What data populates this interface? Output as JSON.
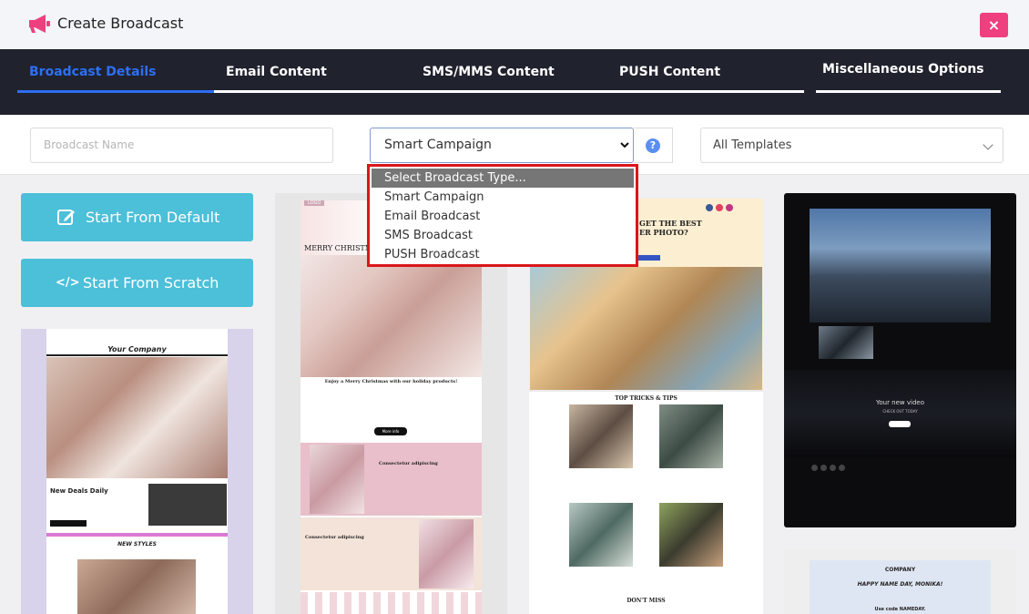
{
  "header": {
    "title": "Create Broadcast",
    "close_label": "×"
  },
  "tabs": [
    {
      "label": "Broadcast Details",
      "active": true
    },
    {
      "label": "Email Content",
      "active": false
    },
    {
      "label": "SMS/MMS Content",
      "active": false
    },
    {
      "label": "PUSH Content",
      "active": false
    },
    {
      "label": "Miscellaneous Options",
      "active": false
    }
  ],
  "form": {
    "name_placeholder": "Broadcast Name",
    "type_value": "Smart Campaign",
    "help_label": "?",
    "templates_value": "All Templates"
  },
  "dropdown": {
    "options": [
      "Select Broadcast Type...",
      "Smart Campaign",
      "Email Broadcast",
      "SMS Broadcast",
      "PUSH Broadcast"
    ],
    "highlighted": "Select Broadcast Type..."
  },
  "actions": {
    "start_default": "Start From Default",
    "start_scratch": "Start From Scratch"
  },
  "templates": {
    "t1": {
      "company": "Your Company",
      "deals": "New Deals Daily",
      "styles": "NEW STYLES"
    },
    "t2": {
      "logo": "LOGO",
      "headline": "MERRY CHRISTM",
      "subhead": "Enjoy a Merry Christmas with our holiday products!",
      "more": "More info",
      "section1": "Consectetur adipiscing",
      "section2": "Consectetur adipiscing"
    },
    "t3": {
      "headline1": "GET THE BEST",
      "headline2": "ER PHOTO?",
      "tips": "TOP TRICKS & TIPS",
      "miss": "DON'T MISS"
    },
    "t4": {
      "video": "Your new video",
      "checkout": "CHECK OUT TODAY"
    },
    "t5": {
      "company": "COMPANY",
      "greeting": "HAPPY NAME DAY, MONIKA!",
      "code": "Use code NAMEDAY."
    }
  },
  "colors": {
    "accent": "#2e6ff2",
    "nav_bg": "#20222e",
    "button": "#4cbfd9",
    "close": "#ee3f7e",
    "dropdown_border": "#d9161a"
  }
}
